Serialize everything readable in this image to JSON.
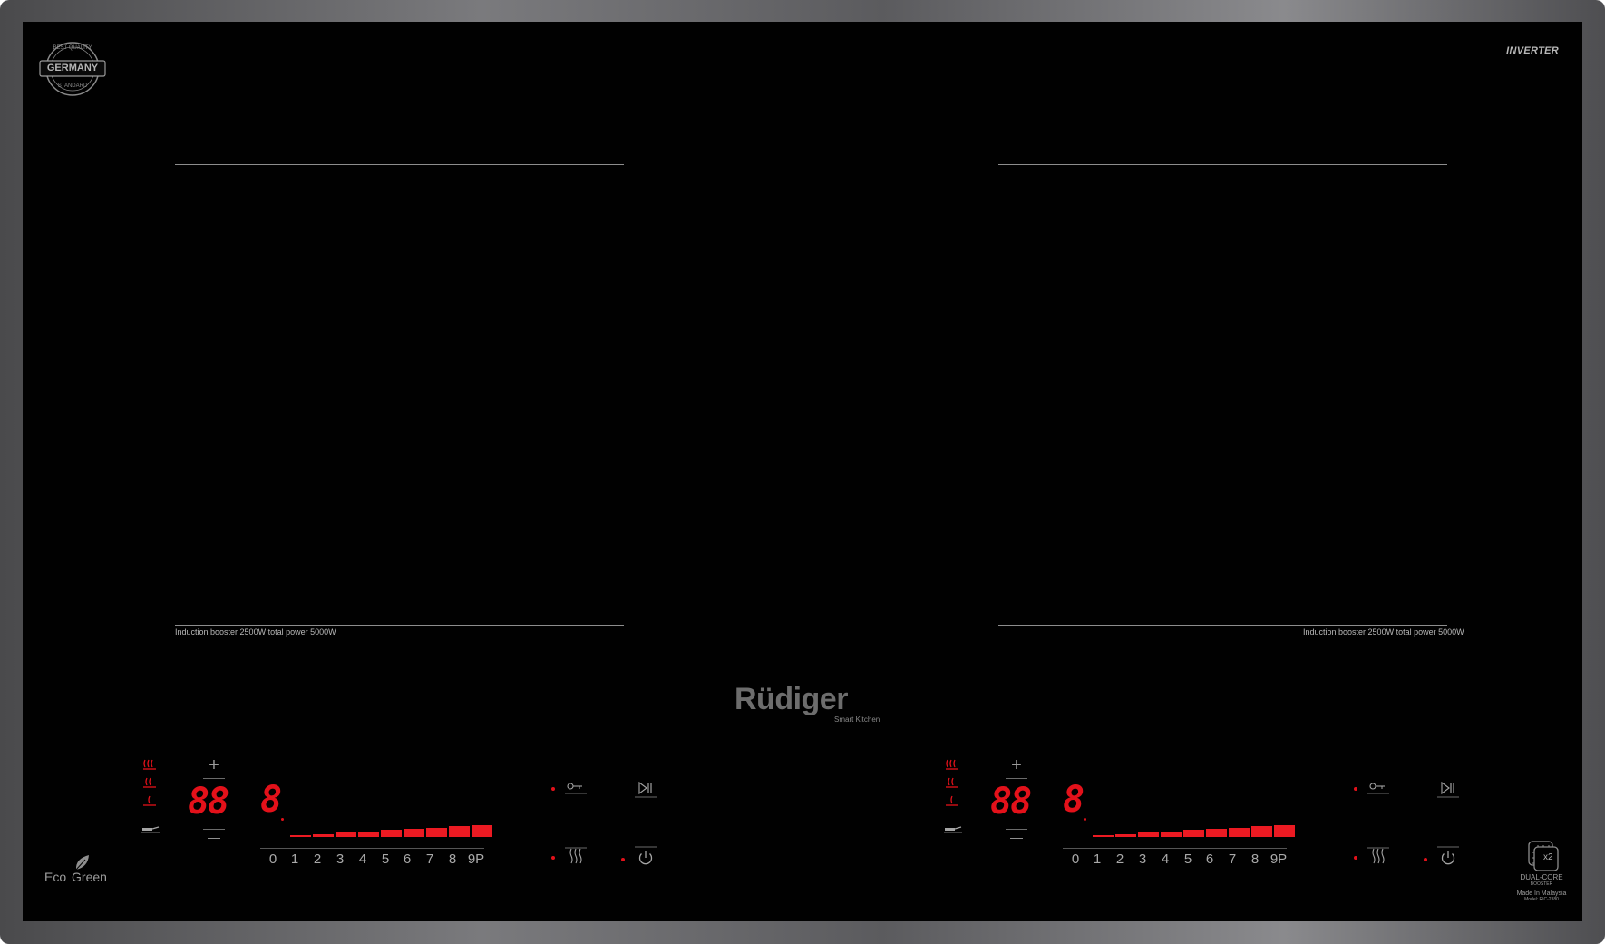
{
  "seal": {
    "top": "BEST QUALITY",
    "center": "GERMANY",
    "bottom": "STANDARD"
  },
  "inverter_logo": "INVERTER",
  "zones": [
    {
      "power_note": "Induction booster 2500W total power 5000W"
    },
    {
      "power_note": "Induction booster 2500W total power 5000W"
    }
  ],
  "brand": {
    "name": "Rüdiger",
    "tagline": "Smart Kitchen"
  },
  "panels": [
    {
      "plus": "+",
      "minus": "—",
      "timer_display": "88",
      "level_display": "8",
      "scale": [
        "0",
        "1",
        "2",
        "3",
        "4",
        "5",
        "6",
        "7",
        "8",
        "9P"
      ],
      "level_fraction": 1.0
    },
    {
      "plus": "+",
      "minus": "—",
      "timer_display": "88",
      "level_display": "8",
      "scale": [
        "0",
        "1",
        "2",
        "3",
        "4",
        "5",
        "6",
        "7",
        "8",
        "9P"
      ],
      "level_fraction": 1.0
    }
  ],
  "eco_logo": {
    "eco": "Eco",
    "green": "Green"
  },
  "dual_core": {
    "badge": "x2",
    "line1": "DUAL-CORE",
    "line2": "BOOSTER",
    "made_in": "Made In Malaysia",
    "model": "Model: RIC-2380"
  },
  "colors": {
    "display_red": "#e3111a",
    "glass": "#010101",
    "frame": "#6d6d70"
  },
  "icons": {
    "heat_levels": "heat-wave-icon",
    "lock": "key-lock-icon",
    "pause": "play-pause-icon",
    "keep_warm": "keep-warm-icon",
    "power": "power-icon",
    "pan": "pan-icon"
  }
}
